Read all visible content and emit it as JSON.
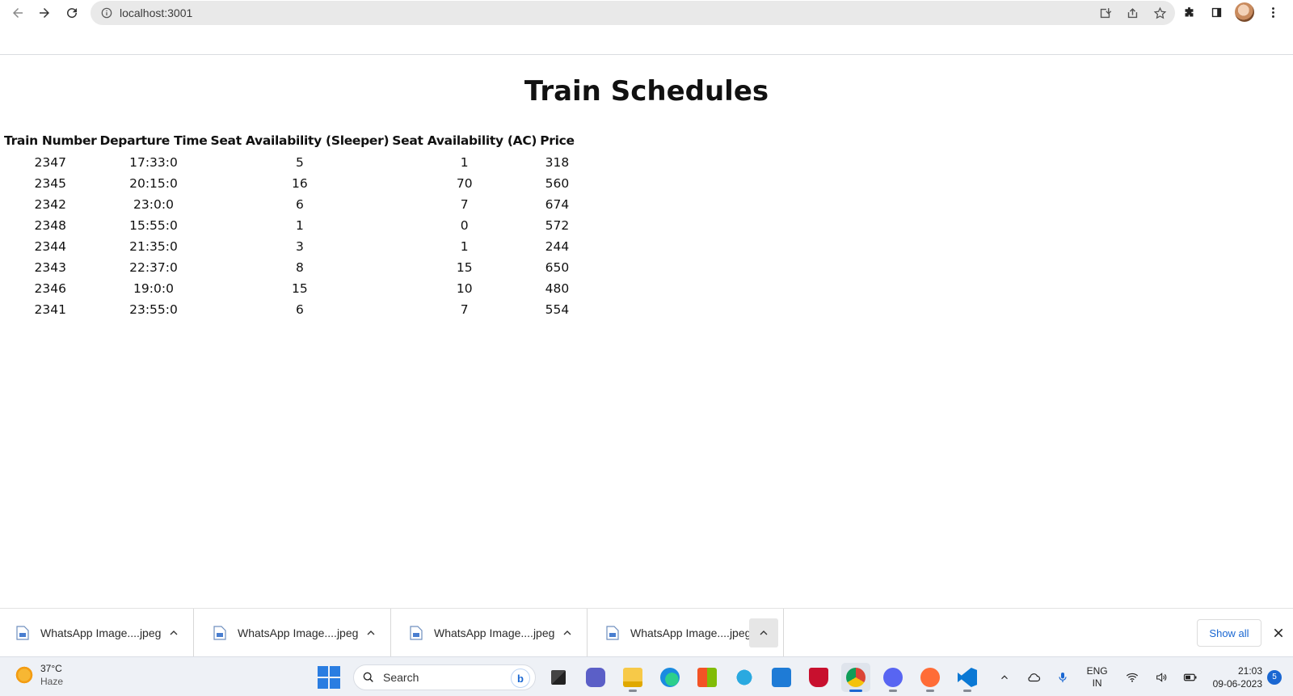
{
  "browser": {
    "url": "localhost:3001"
  },
  "page": {
    "title": "Train Schedules"
  },
  "table": {
    "headers": [
      "Train Number",
      "Departure Time",
      "Seat Availability (Sleeper)",
      "Seat Availability (AC)",
      "Price"
    ],
    "rows": [
      [
        "2347",
        "17:33:0",
        "5",
        "1",
        "318"
      ],
      [
        "2345",
        "20:15:0",
        "16",
        "70",
        "560"
      ],
      [
        "2342",
        "23:0:0",
        "6",
        "7",
        "674"
      ],
      [
        "2348",
        "15:55:0",
        "1",
        "0",
        "572"
      ],
      [
        "2344",
        "21:35:0",
        "3",
        "1",
        "244"
      ],
      [
        "2343",
        "22:37:0",
        "8",
        "15",
        "650"
      ],
      [
        "2346",
        "19:0:0",
        "15",
        "10",
        "480"
      ],
      [
        "2341",
        "23:55:0",
        "6",
        "7",
        "554"
      ]
    ]
  },
  "downloads": {
    "items": [
      {
        "name": "WhatsApp Image....jpeg"
      },
      {
        "name": "WhatsApp Image....jpeg"
      },
      {
        "name": "WhatsApp Image....jpeg"
      },
      {
        "name": "WhatsApp Image....jpeg"
      }
    ],
    "show_all_label": "Show all"
  },
  "taskbar": {
    "weather_temp": "37°C",
    "weather_condition": "Haze",
    "search_placeholder": "Search",
    "language": "ENG",
    "region": "IN",
    "time": "21:03",
    "date": "09-06-2023",
    "notification_count": "5"
  },
  "colors": {
    "accent": "#1a67d2",
    "omnibox_bg": "#e9e9e9",
    "taskbar_bg": "#eef1f6"
  }
}
